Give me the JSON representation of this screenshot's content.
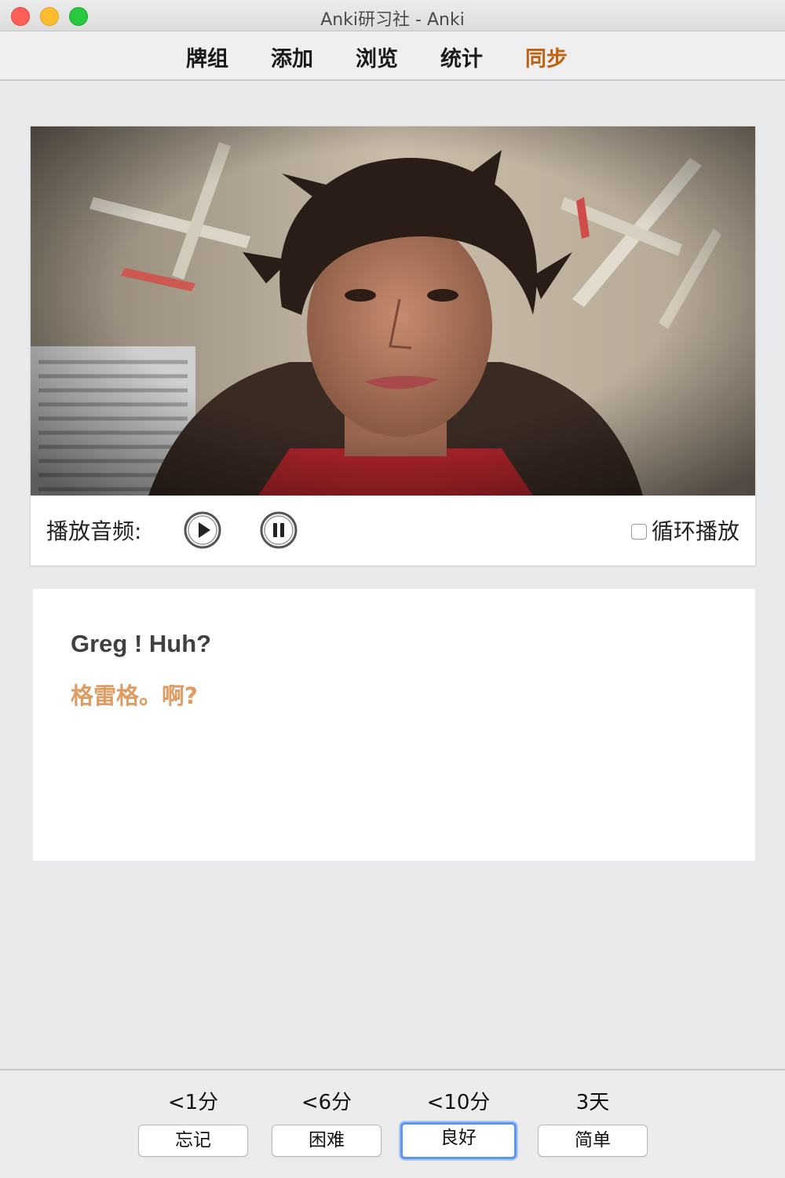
{
  "window": {
    "title": "Anki研习社 - Anki"
  },
  "toolbar": {
    "items": [
      {
        "label": "牌组"
      },
      {
        "label": "添加"
      },
      {
        "label": "浏览"
      },
      {
        "label": "统计"
      },
      {
        "label": "同步"
      }
    ],
    "highlight_color": "#c1600f"
  },
  "player": {
    "audio_label": "播放音频:",
    "play_icon": "play-icon",
    "pause_icon": "pause-icon",
    "loop_label": "循环播放",
    "loop_checked": false
  },
  "card": {
    "english": "Greg ! Huh?",
    "chinese": "格雷格。啊?",
    "chinese_color": "#de9c62"
  },
  "answers": [
    {
      "interval": "<1分",
      "label": "忘记"
    },
    {
      "interval": "<6分",
      "label": "困难"
    },
    {
      "interval": "<10分",
      "label": "良好",
      "focused": true
    },
    {
      "interval": "3天",
      "label": "简单"
    }
  ]
}
